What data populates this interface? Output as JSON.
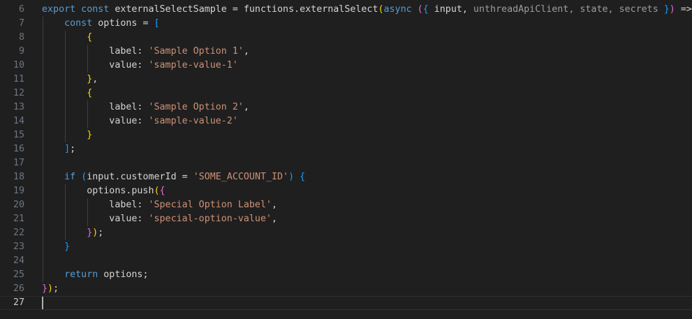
{
  "editor": {
    "current_line": 27,
    "lines": [
      {
        "n": "6",
        "g": [],
        "t": [
          [
            "export const ",
            "kw"
          ],
          [
            "externalSelectSample = functions.externalSelect",
            "txt"
          ],
          [
            "(",
            "b1"
          ],
          [
            "async ",
            "kw"
          ],
          [
            "(",
            "b2"
          ],
          [
            "{ ",
            "b3"
          ],
          [
            "input, ",
            "txt"
          ],
          [
            "unthreadApiClient, state, secrets ",
            "dim"
          ],
          [
            "}",
            "b3"
          ],
          [
            ")",
            "b2"
          ],
          [
            " => ",
            "txt"
          ],
          [
            "{",
            "b2"
          ]
        ]
      },
      {
        "n": "7",
        "g": [
          0
        ],
        "t": [
          [
            "    ",
            "txt"
          ],
          [
            "const ",
            "kw"
          ],
          [
            "options = ",
            "txt"
          ],
          [
            "[",
            "b3"
          ]
        ]
      },
      {
        "n": "8",
        "g": [
          0,
          4
        ],
        "t": [
          [
            "        ",
            "txt"
          ],
          [
            "{",
            "b1"
          ]
        ]
      },
      {
        "n": "9",
        "g": [
          0,
          4,
          8
        ],
        "t": [
          [
            "            label: ",
            "txt"
          ],
          [
            "'Sample Option 1'",
            "str"
          ],
          [
            ",",
            "txt"
          ]
        ]
      },
      {
        "n": "10",
        "g": [
          0,
          4,
          8
        ],
        "t": [
          [
            "            value: ",
            "txt"
          ],
          [
            "'sample-value-1'",
            "str"
          ]
        ]
      },
      {
        "n": "11",
        "g": [
          0,
          4
        ],
        "t": [
          [
            "        ",
            "txt"
          ],
          [
            "}",
            "b1"
          ],
          [
            ",",
            "txt"
          ]
        ]
      },
      {
        "n": "12",
        "g": [
          0,
          4
        ],
        "t": [
          [
            "        ",
            "txt"
          ],
          [
            "{",
            "b1"
          ]
        ]
      },
      {
        "n": "13",
        "g": [
          0,
          4,
          8
        ],
        "t": [
          [
            "            label: ",
            "txt"
          ],
          [
            "'Sample Option 2'",
            "str"
          ],
          [
            ",",
            "txt"
          ]
        ]
      },
      {
        "n": "14",
        "g": [
          0,
          4,
          8
        ],
        "t": [
          [
            "            value: ",
            "txt"
          ],
          [
            "'sample-value-2'",
            "str"
          ]
        ]
      },
      {
        "n": "15",
        "g": [
          0,
          4
        ],
        "t": [
          [
            "        ",
            "txt"
          ],
          [
            "}",
            "b1"
          ]
        ]
      },
      {
        "n": "16",
        "g": [
          0
        ],
        "t": [
          [
            "    ",
            "txt"
          ],
          [
            "]",
            "b3"
          ],
          [
            ";",
            "txt"
          ]
        ]
      },
      {
        "n": "17",
        "g": [
          0
        ],
        "t": []
      },
      {
        "n": "18",
        "g": [
          0
        ],
        "t": [
          [
            "    ",
            "txt"
          ],
          [
            "if ",
            "kw"
          ],
          [
            "(",
            "b3"
          ],
          [
            "input.customerId = ",
            "txt"
          ],
          [
            "'SOME_ACCOUNT_ID'",
            "str"
          ],
          [
            ")",
            "b3"
          ],
          [
            " ",
            "txt"
          ],
          [
            "{",
            "b3"
          ]
        ]
      },
      {
        "n": "19",
        "g": [
          0,
          4
        ],
        "t": [
          [
            "        options.push",
            "txt"
          ],
          [
            "(",
            "b1"
          ],
          [
            "{",
            "b2"
          ]
        ]
      },
      {
        "n": "20",
        "g": [
          0,
          4,
          8
        ],
        "t": [
          [
            "            label: ",
            "txt"
          ],
          [
            "'Special Option Label'",
            "str"
          ],
          [
            ",",
            "txt"
          ]
        ]
      },
      {
        "n": "21",
        "g": [
          0,
          4,
          8
        ],
        "t": [
          [
            "            value: ",
            "txt"
          ],
          [
            "'special-option-value'",
            "str"
          ],
          [
            ",",
            "txt"
          ]
        ]
      },
      {
        "n": "22",
        "g": [
          0,
          4
        ],
        "t": [
          [
            "        ",
            "txt"
          ],
          [
            "}",
            "b2"
          ],
          [
            ")",
            "b1"
          ],
          [
            ";",
            "txt"
          ]
        ]
      },
      {
        "n": "23",
        "g": [
          0
        ],
        "t": [
          [
            "    ",
            "txt"
          ],
          [
            "}",
            "b3"
          ]
        ]
      },
      {
        "n": "24",
        "g": [
          0
        ],
        "t": []
      },
      {
        "n": "25",
        "g": [
          0
        ],
        "t": [
          [
            "    ",
            "txt"
          ],
          [
            "return ",
            "kw"
          ],
          [
            "options;",
            "txt"
          ]
        ]
      },
      {
        "n": "26",
        "g": [],
        "t": [
          [
            "}",
            "b2"
          ],
          [
            ")",
            "b1"
          ],
          [
            ";",
            "txt"
          ]
        ]
      },
      {
        "n": "27",
        "g": [],
        "t": []
      }
    ]
  }
}
